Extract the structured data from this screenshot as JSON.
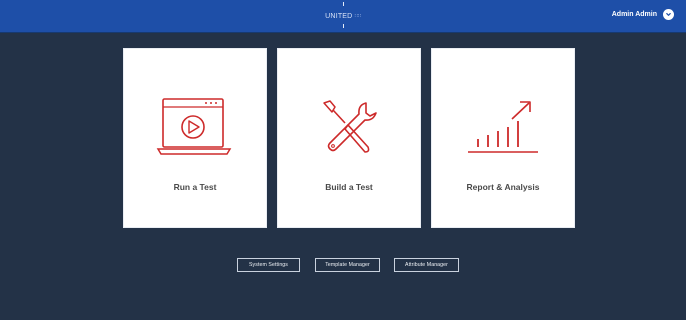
{
  "header": {
    "logo_text": "UNITED",
    "logo_small": "∷∷",
    "user_name": "Admin Admin"
  },
  "cards": [
    {
      "label": "Run a Test",
      "icon": "play-window-icon"
    },
    {
      "label": "Build a Test",
      "icon": "wrench-screwdriver-icon"
    },
    {
      "label": "Report & Analysis",
      "icon": "bar-chart-growth-icon"
    }
  ],
  "buttons": {
    "system_settings": "System Settings",
    "template_manager": "Template Manager",
    "attribute_manager": "Attribute Manager"
  },
  "colors": {
    "top_bar": "#1e4fa8",
    "background": "#233247",
    "icon_accent": "#cd2a2a",
    "card_bg": "#ffffff"
  }
}
